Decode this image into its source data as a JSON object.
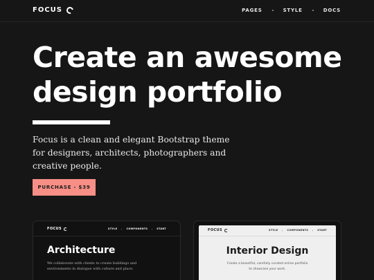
{
  "navbar": {
    "brand": "FOCUS",
    "links": [
      "PAGES",
      "STYLE",
      "DOCS"
    ]
  },
  "hero": {
    "title": "Create an awesome design portfolio",
    "description": "Focus is a clean and elegant Bootstrap theme for designers, architects, photographers and creative people.",
    "cta_label": "PURCHASE - $39"
  },
  "previews": {
    "dark": {
      "brand": "FOCUS",
      "links": [
        "STYLE",
        "COMPONENTS",
        "START"
      ],
      "title": "Architecture",
      "text": "We collaborate with clients to create buildings and environments in dialogue with culture and place."
    },
    "light": {
      "brand": "FOCUS",
      "links": [
        "STYLE",
        "COMPONENTS",
        "START"
      ],
      "title": "Interior Design",
      "text": "Create a beautiful, carefully curated online portfolio to showcase your work."
    }
  },
  "colors": {
    "background": "#161616",
    "accent": "#f78f86",
    "text": "#ffffff"
  }
}
